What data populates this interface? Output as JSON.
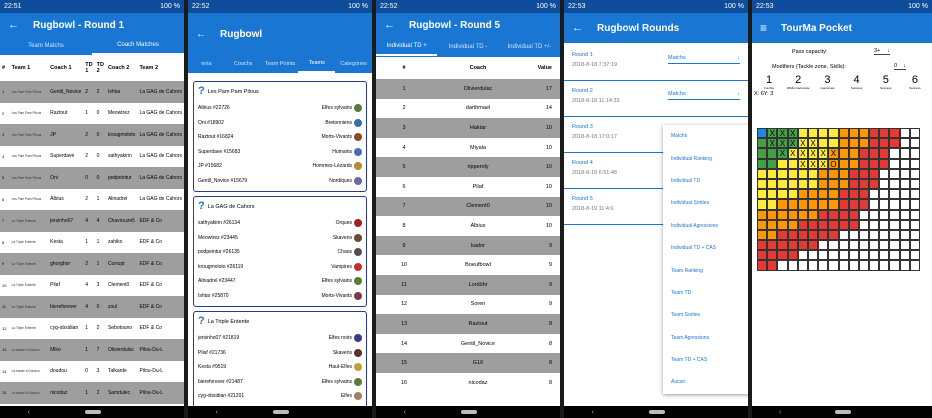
{
  "s1": {
    "status": {
      "time": "22:51",
      "right": "100 %"
    },
    "title": "Rugbowl - Round 1",
    "tabs": [
      "Team Matchs",
      "Coach Matches"
    ],
    "headers": [
      "#",
      "Team 1",
      "Coach 1",
      "TD 1",
      "TD 2",
      "Coach 2",
      "Team 2"
    ],
    "rows": [
      [
        "1",
        "Les Pam Pam Pilous",
        "Gentil_Novice",
        "2",
        "2",
        "Ishtar",
        "La GAG de Cahors"
      ],
      [
        "2",
        "Les Pam Pam Pilous",
        "Raztout",
        "1",
        "0",
        "Meowtrez",
        "La GAG de Cahors"
      ],
      [
        "3",
        "Les Pam Pam Pilous",
        "JP",
        "2",
        "0",
        "krougmoloto",
        "La GAG de Cahors"
      ],
      [
        "4",
        "Les Pam Pam Pilous",
        "Superdave",
        "2",
        "0",
        "sathyakirin",
        "La GAG de Cahors"
      ],
      [
        "5",
        "Les Pam Pam Pilous",
        "Oni",
        "0",
        "0",
        "podpeintur",
        "La GAG de Cahors"
      ],
      [
        "6",
        "Les Pam Pam Pilous",
        "Albius",
        "2",
        "1",
        "Alinadrel",
        "La GAG de Cahors"
      ],
      [
        "7",
        "La Triple Entente",
        "jersinho07",
        "4",
        "4",
        "Chavrouze5",
        "EDF & Co"
      ],
      [
        "8",
        "La Triple Entente",
        "Kesta",
        "1",
        "1",
        "zahiko",
        "EDF & Co"
      ],
      [
        "9",
        "La Triple Entente",
        "ghorghor",
        "2",
        "1",
        "Corrupt",
        "EDF & Co"
      ],
      [
        "10",
        "La Triple Entente",
        "Pilaf",
        "4",
        "3",
        "Clement0",
        "EDF & Co"
      ],
      [
        "11",
        "La Triple Entente",
        "bierefo­rever",
        "4",
        "0",
        "zoul",
        "EDF & Co"
      ],
      [
        "12",
        "La Triple Entente",
        "cyg-obsidian",
        "1",
        "2",
        "Sebotouno",
        "EDF & Co"
      ],
      [
        "13",
        "La bande à Doudou",
        "Miko",
        "1",
        "7",
        "Olivierdulac",
        "Pilou-Du-L"
      ],
      [
        "14",
        "La bande à Doudou",
        "doudou",
        "0",
        "3",
        "Talkarde",
        "Pilou-Du-L"
      ],
      [
        "15",
        "La bande à Doudou",
        "nicodaz",
        "1",
        "2",
        "Samdulec",
        "Pilou-Du-L"
      ],
      [
        "16",
        "La bande à Doudou",
        "TomTom",
        "0",
        "2",
        "Fanny",
        "Pilou-Du-L"
      ]
    ]
  },
  "s2": {
    "status": {
      "time": "22:52",
      "right": "100 %"
    },
    "title": "Rugbowl",
    "tabs": [
      "ieria",
      "Coachs",
      "Team Points",
      "Teams",
      "Categories"
    ],
    "cards": [
      {
        "name": "Les Pam Pam Pilous",
        "rows": [
          [
            "Albius #22726",
            "Elfes sylvains"
          ],
          [
            "Oni #18902",
            "Bretonniens"
          ],
          [
            "Raztout #16824",
            "Morts-Vivants"
          ],
          [
            "Superdave #15683",
            "Humains"
          ],
          [
            "JP #15682",
            "Hommes-Lézards"
          ],
          [
            "Gentil_Novice #15679",
            "Nordiques"
          ]
        ]
      },
      {
        "name": "La GAG de Cahors",
        "rows": [
          [
            "sathyakirin #26134",
            "Orques"
          ],
          [
            "Meowtrez #23445",
            "Skavens"
          ],
          [
            "podpeintur #26135",
            "Chaos"
          ],
          [
            "krougmoloto #26119",
            "Vampires"
          ],
          [
            "Alinadrel #23447",
            "Elfes sylvains"
          ],
          [
            "Ishtar #25870",
            "Morts-Vivants"
          ]
        ]
      },
      {
        "name": "La Triple Entente",
        "rows": [
          [
            "jersinho07 #21819",
            "Elfes noirs"
          ],
          [
            "Pilaf #21736",
            "Skavens"
          ],
          [
            "Kesta #9519",
            "Haut-Elfes"
          ],
          [
            "biereforever #21487",
            "Elfes sylvains"
          ],
          [
            "cyg-obsidian #21201",
            "Elfes"
          ],
          [
            "ghorghor #21919",
            "Nécromantiques"
          ]
        ]
      }
    ]
  },
  "s3": {
    "status": {
      "time": "22:52",
      "right": "100 %"
    },
    "title": "Rugbowl - Round 5",
    "tabs": [
      "Individual TD +",
      "Individual TD -",
      "Individual TD +/-"
    ],
    "headers": [
      "#",
      "Coach",
      "Value"
    ],
    "rows": [
      [
        "1",
        "Olivierdulac",
        "17"
      ],
      [
        "2",
        "darthmael",
        "14"
      ],
      [
        "3",
        "Haktar",
        "10"
      ],
      [
        "4",
        "Miyala",
        "10"
      ],
      [
        "5",
        "ripperoly",
        "10"
      ],
      [
        "6",
        "Pilaf",
        "10"
      ],
      [
        "7",
        "Clement0",
        "10"
      ],
      [
        "8",
        "Albius",
        "10"
      ],
      [
        "9",
        "kador",
        "9"
      ],
      [
        "10",
        "Boeufbowl",
        "9"
      ],
      [
        "11",
        "Lordûhr",
        "9"
      ],
      [
        "12",
        "Soren",
        "9"
      ],
      [
        "13",
        "Raztout",
        "8"
      ],
      [
        "14",
        "Gentil_Novice",
        "8"
      ],
      [
        "15",
        "G16",
        "8"
      ],
      [
        "16",
        "nicodaz",
        "8"
      ]
    ]
  },
  "s4": {
    "status": {
      "time": "22:53",
      "right": "100 %"
    },
    "title": "Rugbowl Rounds",
    "select_label": "Matchs",
    "rounds": [
      {
        "n": "Round 1",
        "d": "2018-8-18 7:37:19"
      },
      {
        "n": "Round 2",
        "d": "2018-8-18 11:14:33"
      },
      {
        "n": "Round 3",
        "d": "2018-8-18 17:0:17"
      },
      {
        "n": "Round 4",
        "d": "2018-8-19 6:51:48"
      },
      {
        "n": "Round 5",
        "d": "2018-8-19 11:4:6"
      }
    ],
    "menu": [
      "Matchs",
      "Individual Ranking",
      "Individual TD",
      "Individual Sorties",
      "Individual Agressions",
      "Individual TD + CAS",
      "Team Ranking",
      "Team TD",
      "Team Sorties",
      "Team Agressions",
      "Team TD + CAS",
      "Aucun"
    ]
  },
  "s5": {
    "status": {
      "time": "22:53",
      "right": "100 %"
    },
    "title": "TourMa Pocket",
    "pass_label": "Pass capacity:",
    "pass_value": "3+",
    "mod_label": "Modifiers (Tackle zone, Skills):",
    "mod_value": "0",
    "scale": [
      {
        "n": "1",
        "l": "Fumble"
      },
      {
        "n": "2",
        "l": "Wildly inaccurate"
      },
      {
        "n": "3",
        "l": "Inaccurate"
      },
      {
        "n": "4",
        "l": "Success"
      },
      {
        "n": "5",
        "l": "Success"
      },
      {
        "n": "6",
        "l": "Success"
      }
    ],
    "coord": "X: 6Y: 3"
  },
  "colors": {
    "primary": "#1976d2",
    "status": "#0d4d9c",
    "stripe": "#9e9e9e"
  }
}
